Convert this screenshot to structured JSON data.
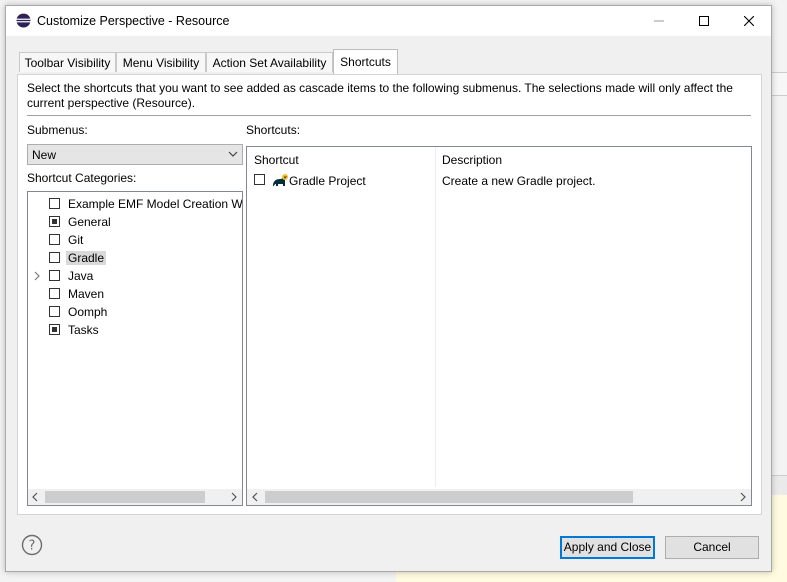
{
  "window": {
    "title": "Customize Perspective - Resource",
    "app_icon": "eclipse-icon",
    "controls": {
      "minimize_icon": "minimize-icon",
      "maximize_icon": "maximize-icon",
      "close_icon": "close-icon"
    }
  },
  "tabs": [
    {
      "label": "Toolbar Visibility",
      "active": false
    },
    {
      "label": "Menu Visibility",
      "active": false
    },
    {
      "label": "Action Set Availability",
      "active": false
    },
    {
      "label": "Shortcuts",
      "active": true
    }
  ],
  "description": "Select the shortcuts that you want to see added as cascade items to the following submenus. The selections made will only affect the current perspective (Resource).",
  "submenus": {
    "label": "Submenus:",
    "selected": "New"
  },
  "categories": {
    "label": "Shortcut Categories:",
    "items": [
      {
        "label": "Example EMF Model Creation Wizards",
        "checked": false,
        "expandable": false,
        "selected": false
      },
      {
        "label": "General",
        "checked": true,
        "expandable": false,
        "selected": false
      },
      {
        "label": "Git",
        "checked": false,
        "expandable": false,
        "selected": false
      },
      {
        "label": "Gradle",
        "checked": false,
        "expandable": false,
        "selected": true
      },
      {
        "label": "Java",
        "checked": false,
        "expandable": true,
        "selected": false
      },
      {
        "label": "Maven",
        "checked": false,
        "expandable": false,
        "selected": false
      },
      {
        "label": "Oomph",
        "checked": false,
        "expandable": false,
        "selected": false
      },
      {
        "label": "Tasks",
        "checked": true,
        "expandable": false,
        "selected": false
      }
    ]
  },
  "shortcuts": {
    "label": "Shortcuts:",
    "columns": {
      "shortcut": "Shortcut",
      "description": "Description"
    },
    "rows": [
      {
        "shortcut": "Gradle Project",
        "description": "Create a new Gradle project.",
        "checked": false,
        "icon": "gradle-icon"
      }
    ]
  },
  "footer": {
    "help_icon": "help-icon",
    "apply_label": "Apply and Close",
    "cancel_label": "Cancel"
  }
}
